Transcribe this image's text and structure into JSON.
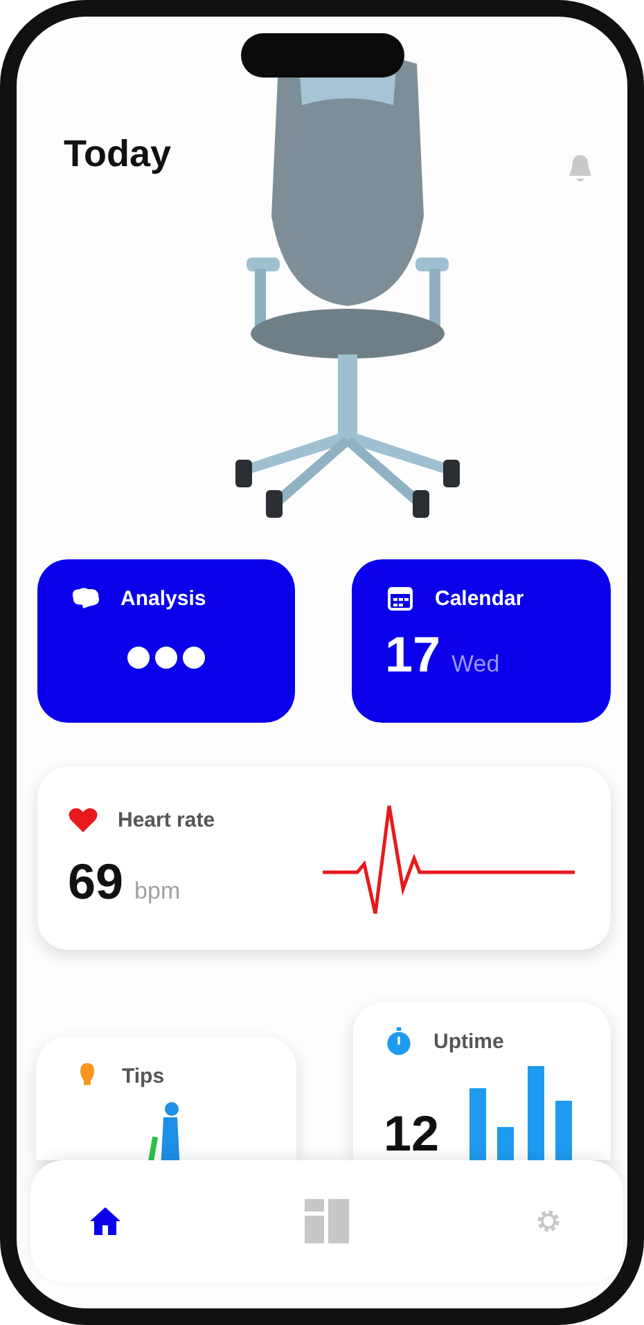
{
  "header": {
    "title": "Today"
  },
  "analysis": {
    "label": "Analysis"
  },
  "calendar": {
    "label": "Calendar",
    "day": "17",
    "weekday": "Wed"
  },
  "heart_rate": {
    "label": "Heart rate",
    "value": "69",
    "unit": "bpm"
  },
  "tips": {
    "label": "Tips"
  },
  "uptime": {
    "label": "Uptime",
    "value": "12"
  },
  "nav": [
    {
      "kind": "home",
      "selected": true
    },
    {
      "kind": "dashboard",
      "selected": false
    },
    {
      "kind": "settings",
      "selected": false
    }
  ]
}
